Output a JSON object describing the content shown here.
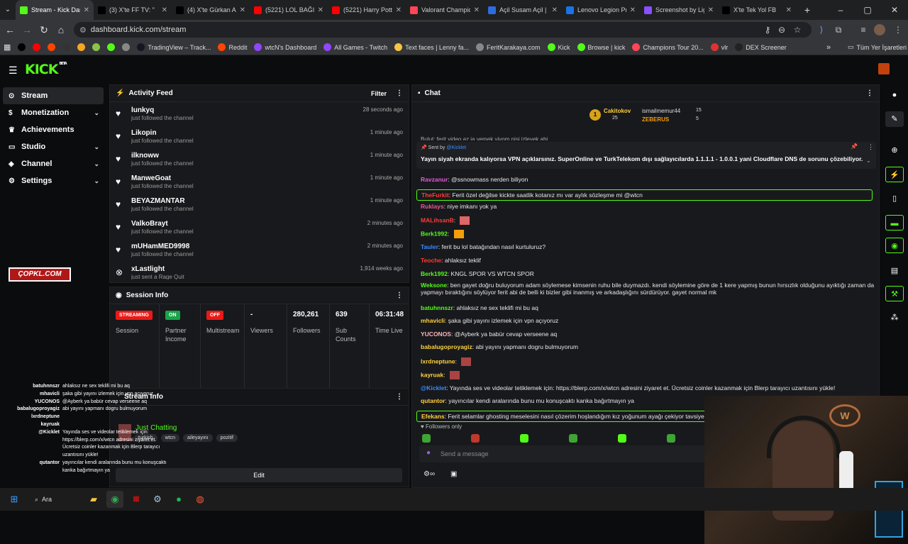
{
  "browser": {
    "tabs": [
      {
        "title": "Stream - Kick Dashboard",
        "icon": "kick-icon",
        "color": "#53fc18",
        "active": true
      },
      {
        "title": "(3) X'te FF TV: \"",
        "icon": "x-icon",
        "color": "#000000"
      },
      {
        "title": "(4) X'te Gürkan Al",
        "icon": "x-icon",
        "color": "#000000"
      },
      {
        "title": "(5221) LOL BAĞIM",
        "icon": "youtube-icon",
        "color": "#ff0000"
      },
      {
        "title": "(5221) Harry Potte",
        "icon": "youtube-icon",
        "color": "#ff0000"
      },
      {
        "title": "Valorant Champio",
        "icon": "valorant-icon",
        "color": "#ff4655"
      },
      {
        "title": "Açil Susam Açil | F",
        "icon": "site-icon",
        "color": "#2d6cdf"
      },
      {
        "title": "Lenovo Legion Pro",
        "icon": "lenovo-icon",
        "color": "#1a73e8"
      },
      {
        "title": "Screenshot by Lig",
        "icon": "lightshot-icon",
        "color": "#8a4fff"
      },
      {
        "title": "X'te Tek Yol FB",
        "icon": "x-icon",
        "color": "#000000"
      }
    ],
    "url": "dashboard.kick.com/stream",
    "bookmarks": [
      {
        "label": "",
        "icon": "x-icon"
      },
      {
        "label": "",
        "icon": "youtube-icon"
      },
      {
        "label": "",
        "icon": "reddit-icon"
      },
      {
        "label": "",
        "icon": "github-icon"
      },
      {
        "label": "",
        "icon": "y-icon"
      },
      {
        "label": "",
        "icon": "game-icon"
      },
      {
        "label": "",
        "icon": "kick-icon"
      },
      {
        "label": "",
        "icon": "globe-icon"
      },
      {
        "label": "TradingView – Track...",
        "icon": "tradingview-icon"
      },
      {
        "label": "Reddit",
        "icon": "reddit-icon"
      },
      {
        "label": "wtcN's Dashboard",
        "icon": "twitch-icon"
      },
      {
        "label": "All Games - Twitch",
        "icon": "twitch-icon"
      },
      {
        "label": "Text faces | Lenny fa...",
        "icon": "smiley-icon"
      },
      {
        "label": "FeritKarakaya.com",
        "icon": "globe-icon"
      },
      {
        "label": "Kick",
        "icon": "kick-icon"
      },
      {
        "label": "Browse | kick",
        "icon": "kick-icon"
      },
      {
        "label": "Champions Tour 20...",
        "icon": "valorant-icon"
      },
      {
        "label": "vlr",
        "icon": "vlr-icon"
      },
      {
        "label": "DEX Screener",
        "icon": "dex-icon"
      }
    ],
    "all_bookmarks": "Tüm Yer İşaretleri"
  },
  "kick": {
    "logo": "KICK",
    "logo_tag": "BETA",
    "sidebar": [
      {
        "label": "Stream",
        "icon": "stream-icon",
        "active": true,
        "chevron": false
      },
      {
        "label": "Monetization",
        "icon": "dollar-icon",
        "chevron": true
      },
      {
        "label": "Achievements",
        "icon": "trophy-icon",
        "chevron": false
      },
      {
        "label": "Studio",
        "icon": "studio-icon",
        "chevron": true
      },
      {
        "label": "Channel",
        "icon": "user-icon",
        "chevron": true
      },
      {
        "label": "Settings",
        "icon": "gear-icon",
        "chevron": true
      }
    ],
    "overlay_logo": "ÇOPKL.COM",
    "activity_feed": {
      "title": "Activity Feed",
      "filter": "Filter",
      "items": [
        {
          "name": "lunkyq",
          "sub": "just followed the channel",
          "time": "28 seconds ago"
        },
        {
          "name": "Likopin",
          "sub": "just followed the channel",
          "time": "1 minute ago"
        },
        {
          "name": "ilknoww",
          "sub": "just followed the channel",
          "time": "1 minute ago"
        },
        {
          "name": "ManweGoat",
          "sub": "just followed the channel",
          "time": "1 minute ago"
        },
        {
          "name": "BEYAZMANTAR",
          "sub": "just followed the channel",
          "time": "1 minute ago"
        },
        {
          "name": "ValkoBrayt",
          "sub": "just followed the channel",
          "time": "2 minutes ago"
        },
        {
          "name": "mUHamMED9998",
          "sub": "just followed the channel",
          "time": "2 minutes ago"
        },
        {
          "name": "xLastlight",
          "sub": "just sent a Rage Quit",
          "time": "1,914 weeks ago"
        }
      ]
    },
    "session": {
      "title": "Session Info",
      "cells": [
        {
          "badge": "STREAMING",
          "badge_color": "#e91916",
          "label": "Session"
        },
        {
          "badge": "ON",
          "badge_color": "#1aa34a",
          "label": "Partner Income"
        },
        {
          "badge": "OFF",
          "badge_color": "#e91916",
          "label": "Multistream"
        },
        {
          "value": "-",
          "label": "Viewers"
        },
        {
          "value": "280,261",
          "label": "Followers"
        },
        {
          "value": "639",
          "label": "Sub Counts"
        },
        {
          "value": "06:31:48",
          "label": "Time Live"
        }
      ]
    },
    "stream_info": {
      "title": "Stream Info",
      "category": "Just Chatting",
      "tags": [
        "turkish",
        "wtcn",
        "aileyayını",
        "pozitif"
      ],
      "edit": "Edit"
    },
    "chat": {
      "title": "Chat",
      "leaders": [
        {
          "rank": "1",
          "name": "Cakitokov",
          "count": "25"
        },
        {
          "name": "ismailmemur44",
          "count": "15"
        },
        {
          "name": "ZEBERUS",
          "count": "5"
        }
      ],
      "pinned_sender": "Sent by",
      "pinned_by": "@Kicklet",
      "pinned_text": "Yayın siyah ekranda kalıyorsa VPN açıklarsınız. SuperOnline ve TurkTelekom dışı sağlayıcılarda 1.1.1.1 - 1.0.0.1 yani Cloudflare DNS de sorunu çözebiliyor.",
      "partial_top": "Bulut: ferit video az ja yemek yiyom nisi izleyek abi",
      "messages": [
        {
          "user": "Ravzanur",
          "color": "#e35bd8",
          "text": "@ssnowmass nerden biliyon",
          "highlight": false
        },
        {
          "user": "TheFurkit",
          "color": "#ff3c3c",
          "text": "Ferit özel değilse kickte saatlik kotanız mı var aylık sözleşme mi @wtcn",
          "highlight": true
        },
        {
          "user": "Ruklays",
          "color": "#e55b92",
          "text": "niye imkanı yok ya",
          "highlight": false
        },
        {
          "user": "MALihsanB",
          "color": "#ff3c3c",
          "text": "",
          "highlight": false
        },
        {
          "user": "Berk1992",
          "color": "#53fc18",
          "text": "",
          "highlight": false
        },
        {
          "user": "Tauler",
          "color": "#3a8cff",
          "text": "ferit bu lol batağından nasıl kurtuluruz?",
          "highlight": false
        },
        {
          "user": "Teoche",
          "color": "#ff3c3c",
          "text": "ahlaksız teklif",
          "highlight": false
        },
        {
          "user": "Berk1992",
          "color": "#53fc18",
          "text": "KNGL SPOR VS WTCN SPOR",
          "highlight": false
        },
        {
          "user": "Weksone",
          "color": "#53fc18",
          "text": "ben gayet doğru buluyorum adam söylemese kimsenin ruhu bile duymazdı. kendi söylemine göre de 1 kere yapmış bunun hırsızlık olduğunu ayıktığı zaman da",
          "text2": "yapmayı bıraktığını söylüyor ferit abi de belli ki bizler gibi inanmış ve arkadaşlığını sürdürüyor. gayet normal mk",
          "highlight": false
        },
        {
          "user": "batuhnnszr",
          "color": "#53fc18",
          "text": "ahlaksız ne sex teklifi mi bu aq",
          "highlight": false
        },
        {
          "user": "mhavicli",
          "color": "#ffd23c",
          "text": "şaka gibi yayını izlemek için vpn açıyoruz",
          "highlight": false
        },
        {
          "user": "YUCONOS",
          "color": "#ffb3c1",
          "text": "@Ayberk ya babür cevap verseene aq",
          "highlight": false
        },
        {
          "user": "babalugoproyagiz",
          "color": "#ffd23c",
          "text": "abi yayını yapmanı dogru bulmuyorum",
          "highlight": false
        },
        {
          "user": "lxrdneptune",
          "color": "#ffd23c",
          "text": "",
          "highlight": false
        },
        {
          "user": "kayruak",
          "color": "#ffd23c",
          "text": "",
          "highlight": false
        },
        {
          "user": "@Kicklet",
          "color": "#3a8cff",
          "text": "Yayında ses ve videolar tetiklemek için: https://blerp.com/x/wtcn adresini ziyaret et. Ücretsiz coinler kazanmak için Blerp tarayıcı uzantısını yükle!",
          "highlight": false
        },
        {
          "user": "qutantor",
          "color": "#ffd23c",
          "text": "yayıncılar kendi aralarında bunu mu konuşcaktı kanka bağırtmayın ya",
          "highlight": false
        },
        {
          "user": "Efekans",
          "color": "#ffd23c",
          "text": "Ferit selamlar ghosting meselesini nasıl çözerim hoşlandığım kız yoğunum ayağı çekiyor tavsiye @w",
          "highlight": true
        }
      ],
      "followers_only": "Followers only",
      "placeholder": "Send a message"
    },
    "overlay_chat": [
      {
        "user": "batuhnnszr",
        "text": "ahlaksız ne sex teklifi mi bu aq"
      },
      {
        "user": "mhavicli",
        "text": "şaka gibi yayını izlemek için vpn açıyoruz"
      },
      {
        "user": "YUCONOS",
        "text": "@Ayberk ya babür cevap verseene aq"
      },
      {
        "user": "babalugoproyagiz",
        "text": "abi yayını yapmanı dogru bulmuyorum"
      },
      {
        "user": "lxrdneptune",
        "text": ""
      },
      {
        "user": "kayruak",
        "text": ""
      },
      {
        "user": "@Kicklet",
        "text": "Yayında ses ve videolar tetiklemek için:"
      },
      {
        "user": "",
        "text": "https://blerp.com/x/wtcn adresini ziyaret et."
      },
      {
        "user": "",
        "text": "Ücretsiz coinler kazanmak için Blerp tarayıcı"
      },
      {
        "user": "",
        "text": "uzantısını yükle!"
      },
      {
        "user": "qutantor",
        "text": "yayıncılar kendi aralarında bunu mu konuşcaktı"
      },
      {
        "user": "",
        "text": "kanka bağırtmayın ya"
      }
    ]
  },
  "taskbar": {
    "search": "Ara"
  },
  "colors": {
    "kick_green": "#53fc18",
    "bg": "#0b0c0e",
    "panel": "#18191c"
  }
}
